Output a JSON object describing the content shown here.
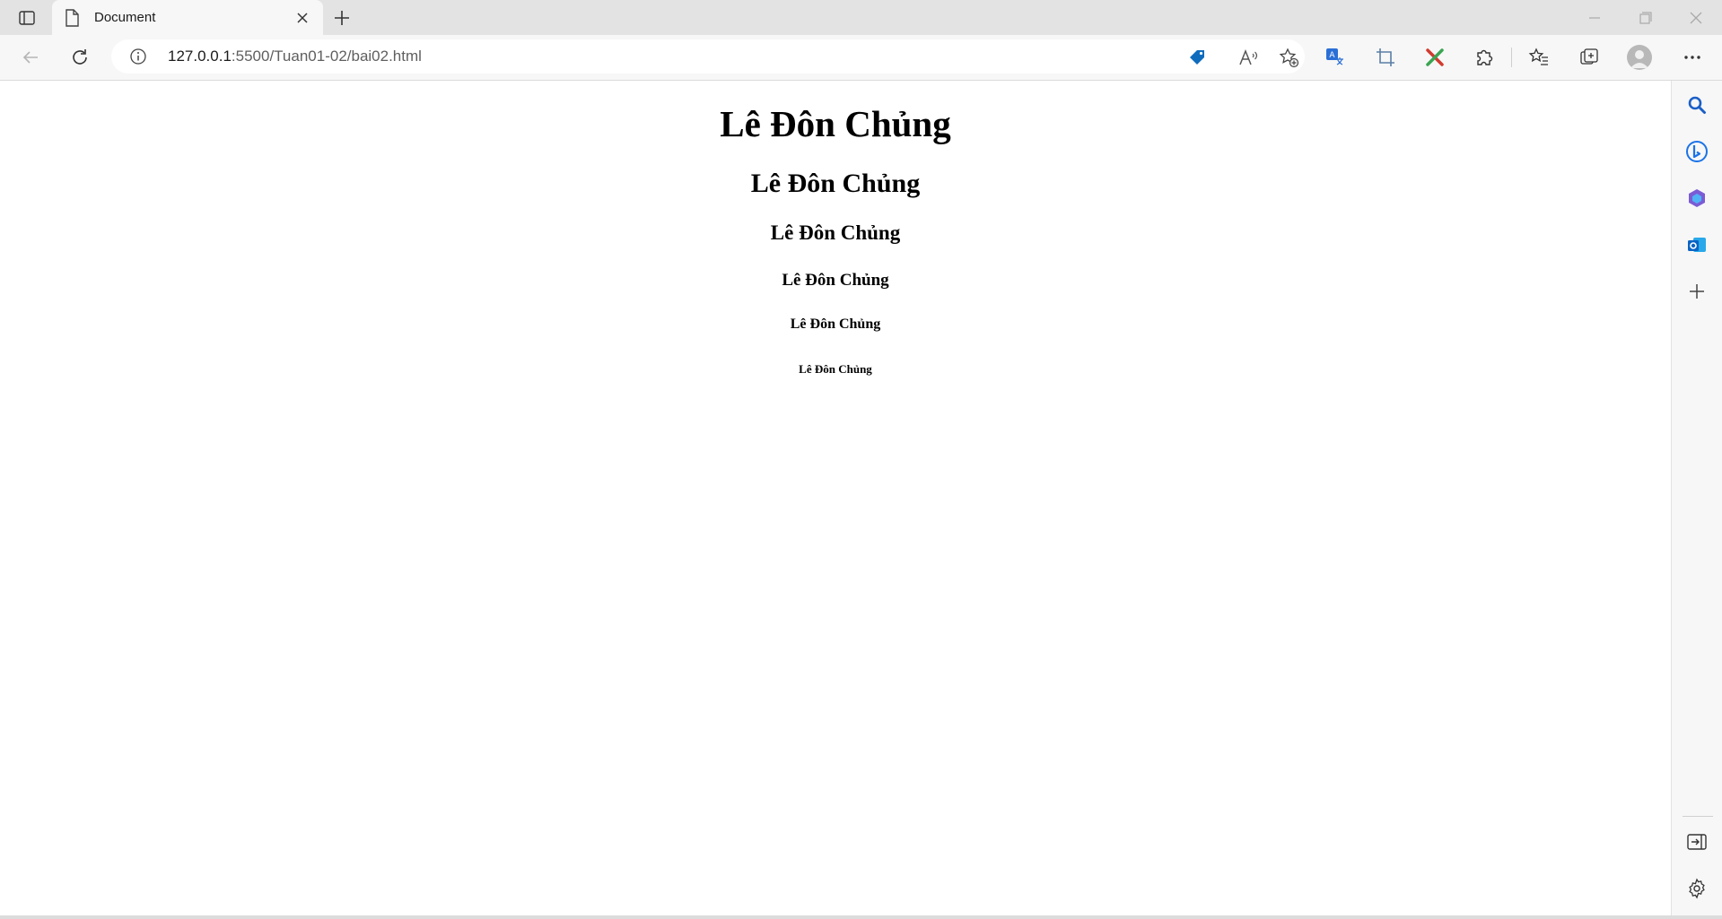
{
  "browser": {
    "tab": {
      "title": "Document"
    },
    "address": {
      "host": "127.0.0.1",
      "rest": ":5500/Tuan01-02/bai02.html"
    },
    "icons": {
      "tab_actions": "tab-actions-icon",
      "page": "document-icon",
      "close_tab": "close-icon",
      "new_tab": "plus-icon",
      "back": "back-arrow-icon",
      "refresh": "refresh-icon",
      "site_info": "info-icon",
      "coupons": "tag-icon",
      "read_aloud": "read-aloud-icon",
      "add_favorite": "favorite-add-icon",
      "translate": "translate-icon",
      "screenshot": "crop-icon",
      "extension_x": "extension-x-icon",
      "extensions": "puzzle-icon",
      "favorites": "favorites-icon",
      "collections": "collections-icon",
      "profile": "avatar",
      "more": "more-icon"
    },
    "accent": "#0f6cbd"
  },
  "page": {
    "headings": {
      "h1": "Lê Đôn Chủng",
      "h2": "Lê Đôn Chủng",
      "h3": "Lê Đôn Chủng",
      "h4": "Lê Đôn Chủng",
      "h5": "Lê Đôn Chủng",
      "h6": "Lê Đôn Chủng"
    }
  },
  "sidebar": {
    "items": [
      "search-icon",
      "bing-copilot-icon",
      "microsoft365-icon",
      "outlook-icon",
      "add-icon"
    ],
    "bottom": [
      "hide-sidebar-icon",
      "settings-icon"
    ]
  }
}
